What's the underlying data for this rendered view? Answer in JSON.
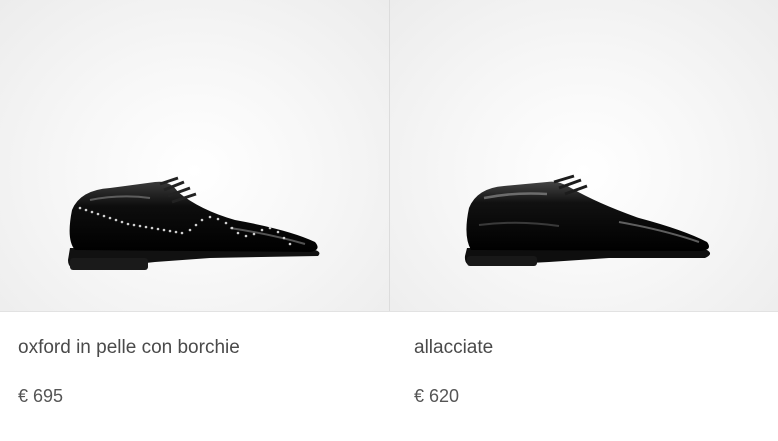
{
  "products": [
    {
      "name": "oxford in pelle con borchie",
      "currency": "€",
      "price": "695",
      "image_icon": "studded-oxford-shoe-icon"
    },
    {
      "name": "allacciate",
      "currency": "€",
      "price": "620",
      "image_icon": "derby-shoe-icon"
    }
  ],
  "colors": {
    "text": "#4a4a4a",
    "divider": "#dcdcdc",
    "image_bg": "#f2f2f2"
  }
}
